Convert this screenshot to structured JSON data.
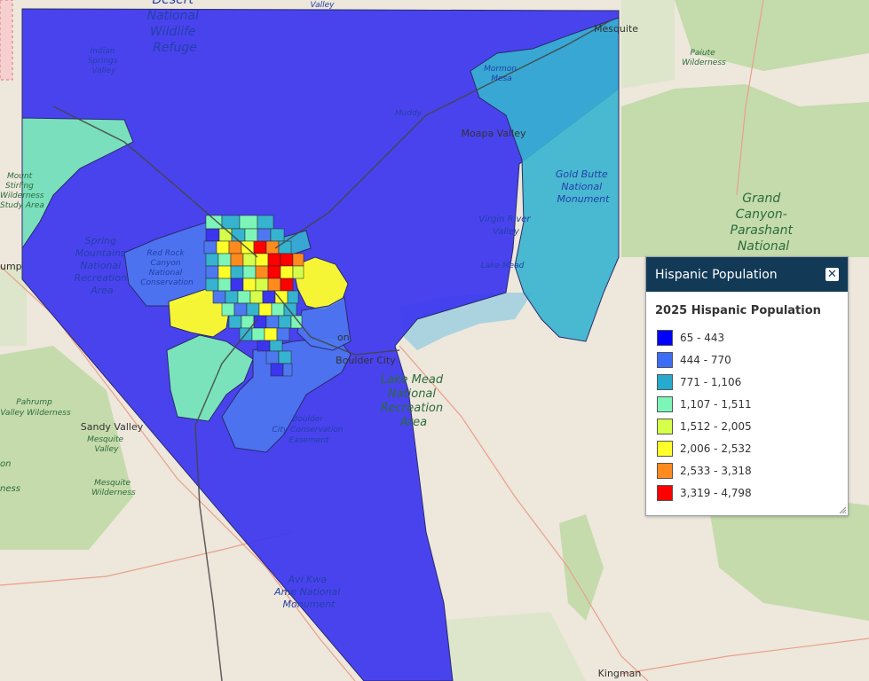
{
  "map": {
    "places": {
      "mesquite": "Mesquite",
      "moapa_valley": "Moapa Valley",
      "boulder_city": "Boulder City",
      "sandy_valley": "Sandy Valley",
      "kingman": "Kingman",
      "pahrump_partial": "ump",
      "henderson_partial": "on"
    },
    "areas": {
      "desert_nwr": [
        "Desert",
        "National",
        "Wildlife",
        "Refuge"
      ],
      "indian_springs": [
        "Indian",
        "Springs",
        "Valley"
      ],
      "mormon_mesa": [
        "Mormon",
        "Mesa"
      ],
      "muddy": "Muddy",
      "gold_butte": [
        "Gold Butte",
        "National",
        "Monument"
      ],
      "paiute": [
        "Paiute",
        "Wilderness"
      ],
      "grand_canyon": [
        "Grand",
        "Canyon-",
        "Parashant",
        "National"
      ],
      "mount_stirling": [
        "Mount",
        "Stirling",
        "Wilderness",
        "Study Area"
      ],
      "spring_mountains": [
        "Spring",
        "Mountains",
        "National",
        "Recreation",
        "Area"
      ],
      "red_rock": [
        "Red Rock",
        "Canyon",
        "National",
        "Conservation"
      ],
      "virgin_river": [
        "Virgin River",
        "Valley"
      ],
      "lake_mead_small": "Lake Mead",
      "lake_mead_nra": [
        "Lake Mead",
        "National",
        "Recreation",
        "Area"
      ],
      "pahrump_valley": [
        "Pahrump",
        "Valley Wilderness"
      ],
      "mesquite_valley": [
        "Mesquite",
        "Valley"
      ],
      "mesquite_wilderness": [
        "Mesquite",
        "Wilderness"
      ],
      "boulder_conservation": [
        "Boulder",
        "City Conservation",
        "Easement"
      ],
      "avi_kwa_ame": [
        "Avi Kwa",
        "Ame National",
        "Monument"
      ],
      "valley_top": "Valley",
      "left_edge": [
        "on",
        "ness"
      ]
    }
  },
  "legend": {
    "title": "Hispanic Population",
    "close_label": "✕",
    "subtitle": "2025 Hispanic Population",
    "items": [
      {
        "range": "65 - 443",
        "color": "#0000ff"
      },
      {
        "range": "444 - 770",
        "color": "#3b6ef5"
      },
      {
        "range": "771 - 1,106",
        "color": "#26aacd"
      },
      {
        "range": "1,107 - 1,511",
        "color": "#7df5b8"
      },
      {
        "range": "1,512 - 2,005",
        "color": "#d5ff4a"
      },
      {
        "range": "2,006 - 2,532",
        "color": "#ffff2a"
      },
      {
        "range": "2,533 - 3,318",
        "color": "#ff8a1e"
      },
      {
        "range": "3,319 - 4,798",
        "color": "#ff0000"
      }
    ]
  }
}
